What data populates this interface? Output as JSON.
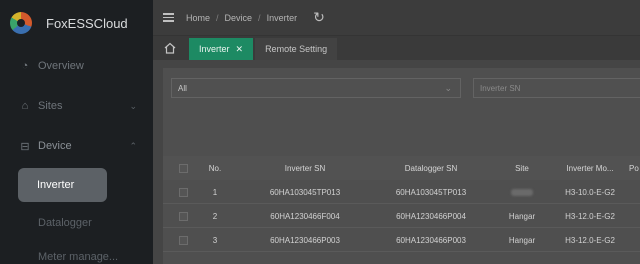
{
  "brand": {
    "name": "FoxESSCloud"
  },
  "sidebar": {
    "items": [
      {
        "label": "Overview",
        "icon": "dashboard-icon"
      },
      {
        "label": "Sites",
        "icon": "home-icon"
      },
      {
        "label": "Device",
        "icon": "device-icon"
      }
    ],
    "device_subitems": [
      {
        "label": "Inverter",
        "selected": true
      },
      {
        "label": "Datalogger",
        "selected": false
      },
      {
        "label": "Meter manage...",
        "selected": false
      }
    ]
  },
  "header": {
    "breadcrumb": [
      "Home",
      "Device",
      "Inverter"
    ],
    "separator": "/"
  },
  "tabs": [
    {
      "label": "Inverter",
      "active": true,
      "closable": true
    },
    {
      "label": "Remote Setting",
      "active": false,
      "closable": false
    }
  ],
  "filters": {
    "status_select_value": "All",
    "sn_placeholder": "Inverter SN"
  },
  "table": {
    "columns": [
      "No.",
      "Inverter SN",
      "Datalogger SN",
      "Site",
      "Inverter Mo...",
      "Po"
    ],
    "rows": [
      {
        "no": "1",
        "inverter_sn": "60HA103045TP013",
        "datalogger_sn": "60HA103045TP013",
        "site": "",
        "model": "H3-10.0-E-G2"
      },
      {
        "no": "2",
        "inverter_sn": "60HA1230466F004",
        "datalogger_sn": "60HA1230466P004",
        "site": "Hangar",
        "model": "H3-12.0-E-G2"
      },
      {
        "no": "3",
        "inverter_sn": "60HA1230466P003",
        "datalogger_sn": "60HA1230466P003",
        "site": "Hangar",
        "model": "H3-12.0-E-G2"
      }
    ]
  },
  "colors": {
    "accent": "#1d8a63",
    "sidebar_bg": "#1c1f22"
  }
}
